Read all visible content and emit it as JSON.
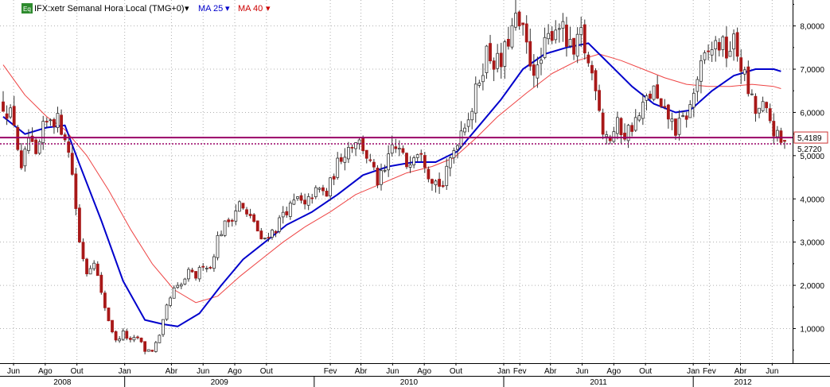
{
  "legend": {
    "badge": "Eq",
    "instrument": "IFX:xetr Semanal Hora Local (TMG+0)",
    "ma_short_label": "MA 25",
    "ma_long_label": "MA 40"
  },
  "colors": {
    "up_candle": "#1e9b1e",
    "down_candle": "#a81818",
    "ma_short": "#0000cc",
    "ma_long": "#ee4444",
    "level_line": "#990066",
    "price_badge_border": "#cc3333",
    "grid": "#b0b0b0",
    "badge_bg": "#2e8b2e"
  },
  "chart_data": {
    "type": "candlestick",
    "title": "",
    "y_range": [
      0.2,
      8.6
    ],
    "y_ticks": [
      "8,0000",
      "7,0000",
      "6,0000",
      "5,0000",
      "4,0000",
      "3,0000",
      "2,0000",
      "1,0000"
    ],
    "y_tick_values": [
      8,
      7,
      6,
      5,
      4,
      3,
      2,
      1
    ],
    "x_range": [
      "2008-05-12",
      "2012-06-25"
    ],
    "month_ticks": [
      {
        "date": "2008-06-01",
        "label": "Jun"
      },
      {
        "date": "2008-08-01",
        "label": "Ago"
      },
      {
        "date": "2008-10-01",
        "label": "Out"
      },
      {
        "date": "2009-01-01",
        "label": "Jan"
      },
      {
        "date": "2009-04-01",
        "label": "Abr"
      },
      {
        "date": "2009-06-01",
        "label": "Jun"
      },
      {
        "date": "2009-08-01",
        "label": "Ago"
      },
      {
        "date": "2009-10-01",
        "label": "Out"
      },
      {
        "date": "2010-02-01",
        "label": "Fev"
      },
      {
        "date": "2010-04-01",
        "label": "Abr"
      },
      {
        "date": "2010-06-01",
        "label": "Jun"
      },
      {
        "date": "2010-08-01",
        "label": "Ago"
      },
      {
        "date": "2010-10-01",
        "label": "Out"
      },
      {
        "date": "2011-01-01",
        "label": "Jan"
      },
      {
        "date": "2011-02-01",
        "label": "Fev"
      },
      {
        "date": "2011-04-01",
        "label": "Abr"
      },
      {
        "date": "2011-06-01",
        "label": "Jun"
      },
      {
        "date": "2011-08-01",
        "label": "Ago"
      },
      {
        "date": "2011-10-01",
        "label": "Out"
      },
      {
        "date": "2012-01-01",
        "label": "Jan"
      },
      {
        "date": "2012-02-01",
        "label": "Fev"
      },
      {
        "date": "2012-04-01",
        "label": "Abr"
      },
      {
        "date": "2012-06-01",
        "label": "Jun"
      }
    ],
    "year_ticks": [
      {
        "date": "2008-01-01",
        "label": "2008"
      },
      {
        "date": "2009-01-01",
        "label": "2009"
      },
      {
        "date": "2010-01-01",
        "label": "2010"
      },
      {
        "date": "2011-01-01",
        "label": "2011"
      },
      {
        "date": "2012-01-01",
        "label": "2012"
      }
    ],
    "close_path": [
      [
        "2008-05-12",
        6.2
      ],
      [
        "2008-06-02",
        5.8
      ],
      [
        "2008-06-16",
        4.6
      ],
      [
        "2008-06-30",
        5.4
      ],
      [
        "2008-07-14",
        4.9
      ],
      [
        "2008-07-28",
        5.6
      ],
      [
        "2008-08-11",
        5.9
      ],
      [
        "2008-08-25",
        5.8
      ],
      [
        "2008-09-08",
        5.5
      ],
      [
        "2008-09-22",
        4.6
      ],
      [
        "2008-10-06",
        3.0
      ],
      [
        "2008-10-20",
        2.3
      ],
      [
        "2008-11-03",
        2.6
      ],
      [
        "2008-11-17",
        1.8
      ],
      [
        "2008-12-01",
        1.2
      ],
      [
        "2008-12-15",
        0.7
      ],
      [
        "2008-12-29",
        0.9
      ],
      [
        "2009-01-12",
        0.7
      ],
      [
        "2009-01-26",
        0.8
      ],
      [
        "2009-02-09",
        0.5
      ],
      [
        "2009-02-23",
        0.5
      ],
      [
        "2009-03-09",
        0.8
      ],
      [
        "2009-03-23",
        1.5
      ],
      [
        "2009-04-06",
        1.9
      ],
      [
        "2009-04-20",
        2.0
      ],
      [
        "2009-05-04",
        2.3
      ],
      [
        "2009-05-18",
        2.2
      ],
      [
        "2009-06-01",
        2.5
      ],
      [
        "2009-06-15",
        2.4
      ],
      [
        "2009-06-29",
        3.1
      ],
      [
        "2009-07-13",
        3.4
      ],
      [
        "2009-07-27",
        3.6
      ],
      [
        "2009-08-10",
        3.9
      ],
      [
        "2009-08-24",
        3.6
      ],
      [
        "2009-09-07",
        3.5
      ],
      [
        "2009-09-21",
        3.0
      ],
      [
        "2009-10-05",
        3.2
      ],
      [
        "2009-10-19",
        3.3
      ],
      [
        "2009-11-02",
        3.7
      ],
      [
        "2009-11-16",
        3.8
      ],
      [
        "2009-11-30",
        4.0
      ],
      [
        "2009-12-14",
        3.8
      ],
      [
        "2009-12-28",
        4.1
      ],
      [
        "2010-01-11",
        4.2
      ],
      [
        "2010-01-25",
        4.1
      ],
      [
        "2010-02-08",
        4.6
      ],
      [
        "2010-02-22",
        5.0
      ],
      [
        "2010-03-08",
        5.2
      ],
      [
        "2010-03-22",
        5.4
      ],
      [
        "2010-04-05",
        5.2
      ],
      [
        "2010-04-19",
        4.8
      ],
      [
        "2010-05-03",
        4.4
      ],
      [
        "2010-05-17",
        4.6
      ],
      [
        "2010-05-31",
        5.2
      ],
      [
        "2010-06-14",
        5.1
      ],
      [
        "2010-06-28",
        4.8
      ],
      [
        "2010-07-12",
        5.1
      ],
      [
        "2010-07-26",
        5.2
      ],
      [
        "2010-08-09",
        4.6
      ],
      [
        "2010-08-23",
        4.4
      ],
      [
        "2010-09-06",
        4.3
      ],
      [
        "2010-09-20",
        4.9
      ],
      [
        "2010-10-04",
        5.4
      ],
      [
        "2010-10-18",
        5.8
      ],
      [
        "2010-11-01",
        6.1
      ],
      [
        "2010-11-15",
        6.8
      ],
      [
        "2010-11-29",
        7.4
      ],
      [
        "2010-12-13",
        7.2
      ],
      [
        "2010-12-27",
        7.1
      ],
      [
        "2011-01-10",
        7.7
      ],
      [
        "2011-01-24",
        8.1
      ],
      [
        "2011-02-07",
        7.8
      ],
      [
        "2011-02-21",
        7.2
      ],
      [
        "2011-03-07",
        6.9
      ],
      [
        "2011-03-21",
        7.5
      ],
      [
        "2011-04-04",
        7.9
      ],
      [
        "2011-04-18",
        8.1
      ],
      [
        "2011-05-02",
        7.6
      ],
      [
        "2011-05-16",
        7.3
      ],
      [
        "2011-05-30",
        7.8
      ],
      [
        "2011-06-13",
        7.1
      ],
      [
        "2011-06-27",
        6.7
      ],
      [
        "2011-07-11",
        5.6
      ],
      [
        "2011-07-25",
        5.4
      ],
      [
        "2011-08-08",
        5.7
      ],
      [
        "2011-08-22",
        5.5
      ],
      [
        "2011-09-05",
        5.7
      ],
      [
        "2011-09-19",
        5.9
      ],
      [
        "2011-10-03",
        6.3
      ],
      [
        "2011-10-17",
        6.5
      ],
      [
        "2011-10-31",
        6.0
      ],
      [
        "2011-11-14",
        5.9
      ],
      [
        "2011-11-28",
        5.6
      ],
      [
        "2011-12-12",
        5.8
      ],
      [
        "2011-12-26",
        6.1
      ],
      [
        "2012-01-09",
        6.8
      ],
      [
        "2012-01-23",
        7.2
      ],
      [
        "2012-02-06",
        7.5
      ],
      [
        "2012-02-20",
        7.6
      ],
      [
        "2012-03-05",
        7.4
      ],
      [
        "2012-03-19",
        7.6
      ],
      [
        "2012-04-02",
        7.1
      ],
      [
        "2012-04-16",
        6.5
      ],
      [
        "2012-04-30",
        6.0
      ],
      [
        "2012-05-14",
        6.1
      ],
      [
        "2012-05-28",
        5.8
      ],
      [
        "2012-06-11",
        5.4
      ],
      [
        "2012-06-18",
        5.27
      ]
    ],
    "ma_short": [
      [
        "2008-05-12",
        5.9
      ],
      [
        "2008-06-23",
        5.5
      ],
      [
        "2008-08-04",
        5.65
      ],
      [
        "2008-09-08",
        5.7
      ],
      [
        "2008-10-06",
        4.8
      ],
      [
        "2008-11-17",
        3.5
      ],
      [
        "2008-12-29",
        2.1
      ],
      [
        "2009-02-09",
        1.2
      ],
      [
        "2009-03-16",
        1.1
      ],
      [
        "2009-04-13",
        1.05
      ],
      [
        "2009-05-25",
        1.35
      ],
      [
        "2009-07-06",
        2.0
      ],
      [
        "2009-08-17",
        2.6
      ],
      [
        "2009-09-28",
        3.0
      ],
      [
        "2009-11-09",
        3.4
      ],
      [
        "2009-12-28",
        3.7
      ],
      [
        "2010-02-15",
        4.1
      ],
      [
        "2010-04-05",
        4.55
      ],
      [
        "2010-05-24",
        4.75
      ],
      [
        "2010-07-12",
        4.85
      ],
      [
        "2010-08-23",
        4.85
      ],
      [
        "2010-10-04",
        5.1
      ],
      [
        "2010-11-15",
        5.7
      ],
      [
        "2010-12-27",
        6.3
      ],
      [
        "2011-02-07",
        7.0
      ],
      [
        "2011-03-21",
        7.35
      ],
      [
        "2011-05-02",
        7.5
      ],
      [
        "2011-06-13",
        7.6
      ],
      [
        "2011-07-25",
        7.1
      ],
      [
        "2011-09-05",
        6.6
      ],
      [
        "2011-10-17",
        6.2
      ],
      [
        "2011-11-28",
        6.0
      ],
      [
        "2011-12-26",
        6.05
      ],
      [
        "2012-02-06",
        6.5
      ],
      [
        "2012-03-19",
        6.85
      ],
      [
        "2012-04-30",
        7.0
      ],
      [
        "2012-06-04",
        7.0
      ],
      [
        "2012-06-18",
        6.95
      ]
    ],
    "ma_long": [
      [
        "2008-05-12",
        7.1
      ],
      [
        "2008-06-23",
        6.4
      ],
      [
        "2008-08-04",
        5.9
      ],
      [
        "2008-09-08",
        5.6
      ],
      [
        "2008-10-20",
        5.0
      ],
      [
        "2008-12-01",
        4.2
      ],
      [
        "2009-01-12",
        3.3
      ],
      [
        "2009-02-23",
        2.5
      ],
      [
        "2009-04-06",
        1.9
      ],
      [
        "2009-05-18",
        1.6
      ],
      [
        "2009-06-29",
        1.75
      ],
      [
        "2009-08-10",
        2.2
      ],
      [
        "2009-09-21",
        2.6
      ],
      [
        "2009-11-02",
        3.0
      ],
      [
        "2009-12-14",
        3.35
      ],
      [
        "2010-02-01",
        3.7
      ],
      [
        "2010-03-22",
        4.1
      ],
      [
        "2010-05-10",
        4.35
      ],
      [
        "2010-06-28",
        4.6
      ],
      [
        "2010-08-16",
        4.75
      ],
      [
        "2010-09-27",
        4.95
      ],
      [
        "2010-11-08",
        5.4
      ],
      [
        "2010-12-20",
        5.9
      ],
      [
        "2011-02-14",
        6.45
      ],
      [
        "2011-04-04",
        6.9
      ],
      [
        "2011-05-23",
        7.2
      ],
      [
        "2011-07-04",
        7.35
      ],
      [
        "2011-08-15",
        7.2
      ],
      [
        "2011-09-26",
        7.0
      ],
      [
        "2011-11-07",
        6.8
      ],
      [
        "2011-12-19",
        6.65
      ],
      [
        "2012-01-30",
        6.6
      ],
      [
        "2012-03-12",
        6.6
      ],
      [
        "2012-04-23",
        6.65
      ],
      [
        "2012-06-04",
        6.6
      ],
      [
        "2012-06-18",
        6.55
      ]
    ],
    "level_solid": 5.4189,
    "level_dotted": 5.272,
    "level_solid_label": "5,4189",
    "level_dotted_label": "5,2720"
  }
}
